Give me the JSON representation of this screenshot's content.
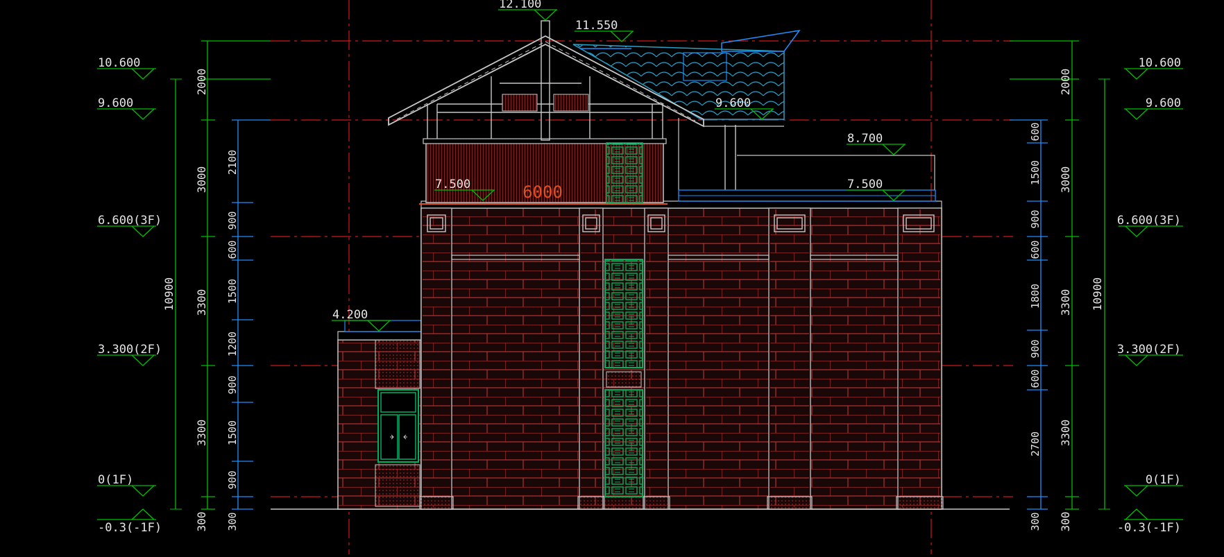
{
  "colors": {
    "background": "#000000",
    "dim_green": "#00c000",
    "dim_blue": "#1e90ff",
    "grid_red": "#d01818",
    "wall": "#c8c8c8",
    "brick": "#b03030",
    "window_green": "#00b060",
    "roof_cyan": "#2aa0c8",
    "text": "#e6e6e6",
    "label_orange": "#e05020"
  },
  "levels_left": [
    {
      "label": "10.600"
    },
    {
      "label": "9.600"
    },
    {
      "label": "6.600(3F)"
    },
    {
      "label": "3.300(2F)"
    },
    {
      "label": "0(1F)"
    },
    {
      "label": "-0.3(-1F)"
    }
  ],
  "levels_right": [
    {
      "label": "10.600"
    },
    {
      "label": "9.600"
    },
    {
      "label": "6.600(3F)"
    },
    {
      "label": "3.300(2F)"
    },
    {
      "label": "0(1F)"
    },
    {
      "label": "-0.3(-1F)"
    }
  ],
  "dims_left_overall": "10900",
  "dims_left_floor": [
    "2000",
    "3000",
    "3300",
    "3300",
    "300"
  ],
  "dims_left_detail": [
    "2100",
    "900",
    "600",
    "1500",
    "1200",
    "900",
    "1500",
    "900",
    "300"
  ],
  "dims_right_overall": "10900",
  "dims_right_floor": [
    "2000",
    "3000",
    "3300",
    "3300",
    "300"
  ],
  "dims_right_detail": [
    "600",
    "1500",
    "900",
    "600",
    "1800",
    "900",
    "600",
    "2700",
    "300"
  ],
  "building_marks": [
    {
      "label": "12.100"
    },
    {
      "label": "11.550"
    },
    {
      "label": "9.600"
    },
    {
      "label": "8.700"
    },
    {
      "label": "7.500"
    },
    {
      "label": "7.500"
    },
    {
      "label": "4.200"
    }
  ],
  "span_label": "6000",
  "icons": [
    "elevation-triangle-icon",
    "door-arrow-icon"
  ]
}
